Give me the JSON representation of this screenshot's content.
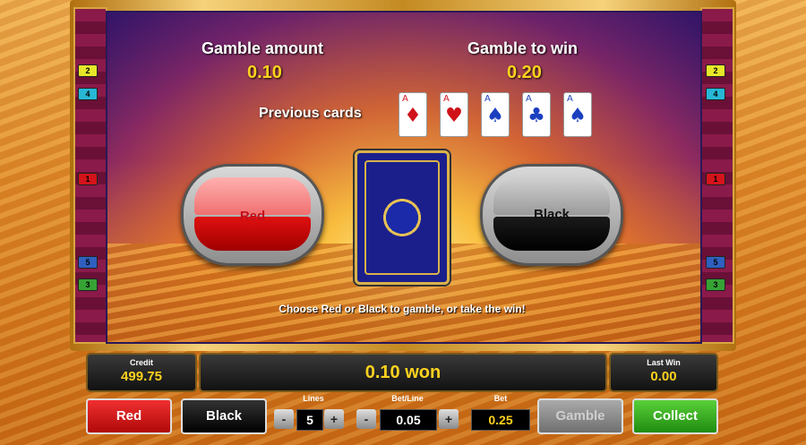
{
  "gamble": {
    "amount_label": "Gamble amount",
    "amount_value": "0.10",
    "to_win_label": "Gamble to win",
    "to_win_value": "0.20",
    "previous_cards_label": "Previous cards",
    "previous_cards": [
      {
        "rank": "A",
        "suit": "♦",
        "color": "red"
      },
      {
        "rank": "A",
        "suit": "♥",
        "color": "red"
      },
      {
        "rank": "A",
        "suit": "♠",
        "color": "black"
      },
      {
        "rank": "A",
        "suit": "♣",
        "color": "black"
      },
      {
        "rank": "A",
        "suit": "♠",
        "color": "black"
      }
    ],
    "red_label": "Red",
    "black_label": "Black",
    "hint": "Choose Red or Black to gamble, or take the win!"
  },
  "side_numbers_left": [
    "2",
    "4",
    "1",
    "5",
    "3"
  ],
  "side_numbers_right": [
    "2",
    "4",
    "1",
    "5",
    "3"
  ],
  "status": {
    "credit_label": "Credit",
    "credit_value": "499.75",
    "message": "0.10 won",
    "last_win_label": "Last Win",
    "last_win_value": "0.00"
  },
  "controls": {
    "red_button": "Red",
    "black_button": "Black",
    "lines_label": "Lines",
    "lines_value": "5",
    "bet_line_label": "Bet/Line",
    "bet_line_value": "0.05",
    "bet_label": "Bet",
    "bet_value": "0.25",
    "gamble_button": "Gamble",
    "collect_button": "Collect",
    "minus": "-",
    "plus": "+"
  },
  "colors": {
    "accent_yellow": "#ffd21e",
    "red": "#d0121a",
    "collect_green": "#2ea01c"
  }
}
